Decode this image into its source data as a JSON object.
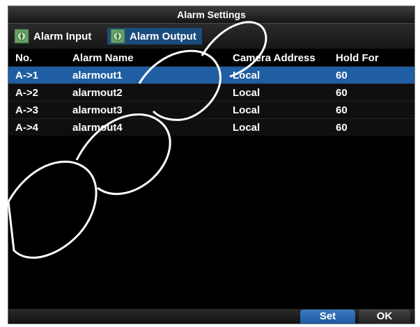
{
  "window": {
    "title": "Alarm Settings"
  },
  "tabs": [
    {
      "label": "Alarm Input",
      "icon": "alarm-input-icon"
    },
    {
      "label": "Alarm Output",
      "icon": "alarm-output-icon"
    }
  ],
  "table": {
    "headers": [
      "No.",
      "Alarm Name",
      "Camera Address",
      "Hold For"
    ],
    "rows": [
      [
        "A->1",
        "alarmout1",
        "Local",
        "60"
      ],
      [
        "A->2",
        "alarmout2",
        "Local",
        "60"
      ],
      [
        "A->3",
        "alarmout3",
        "Local",
        "60"
      ],
      [
        "A->4",
        "alarmout4",
        "Local",
        "60"
      ]
    ]
  },
  "footer": {
    "set_label": "Set",
    "ok_label": "OK"
  },
  "colors": {
    "selected_row": "#1f5ea2",
    "accent": "#3b78c3"
  }
}
